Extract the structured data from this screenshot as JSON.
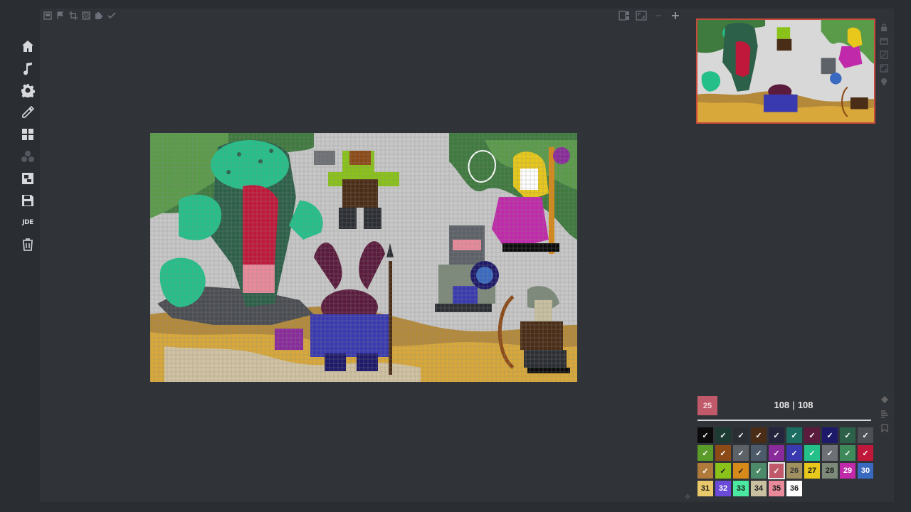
{
  "palette": {
    "current": "25",
    "count_left": "108",
    "count_right": "108",
    "separator": "|",
    "swatches": [
      [
        {
          "label": "✓",
          "bg": "#0b0b0b",
          "fg": "#ffffff"
        },
        {
          "label": "✓",
          "bg": "#1d3b33",
          "fg": "#ffffff"
        },
        {
          "label": "✓",
          "bg": "#2b2e33",
          "fg": "#ffffff"
        },
        {
          "label": "✓",
          "bg": "#4a2d17",
          "fg": "#ffffff"
        },
        {
          "label": "✓",
          "bg": "#25253d",
          "fg": "#ffffff"
        },
        {
          "label": "✓",
          "bg": "#1c6d62",
          "fg": "#ffffff"
        },
        {
          "label": "✓",
          "bg": "#5a1b3d",
          "fg": "#ffffff"
        },
        {
          "label": "✓",
          "bg": "#1e1a6a",
          "fg": "#ffffff"
        },
        {
          "label": "✓",
          "bg": "#2d6049",
          "fg": "#ffffff"
        },
        {
          "label": "✓",
          "bg": "#4d5055",
          "fg": "#ffffff"
        }
      ],
      [
        {
          "label": "✓",
          "bg": "#5a9b2a",
          "fg": "#ffffff"
        },
        {
          "label": "✓",
          "bg": "#8c4a17",
          "fg": "#ffffff"
        },
        {
          "label": "✓",
          "bg": "#5d6268",
          "fg": "#ffffff"
        },
        {
          "label": "✓",
          "bg": "#4d5a6a",
          "fg": "#ffffff"
        },
        {
          "label": "✓",
          "bg": "#8a2b9b",
          "fg": "#ffffff"
        },
        {
          "label": "✓",
          "bg": "#3a3ab0",
          "fg": "#ffffff"
        },
        {
          "label": "✓",
          "bg": "#25c08a",
          "fg": "#ffffff"
        },
        {
          "label": "✓",
          "bg": "#6d7075",
          "fg": "#ffffff"
        },
        {
          "label": "✓",
          "bg": "#3f8a5a",
          "fg": "#ffffff"
        },
        {
          "label": "✓",
          "bg": "#c0183a",
          "fg": "#ffffff"
        }
      ],
      [
        {
          "label": "✓",
          "bg": "#b07a3a",
          "fg": "#ffffff"
        },
        {
          "label": "✓",
          "bg": "#8ac21a",
          "fg": "#1d1d1d"
        },
        {
          "label": "✓",
          "bg": "#d68a1a",
          "fg": "#1d1d1d"
        },
        {
          "label": "✓",
          "bg": "#4d8a6a",
          "fg": "#ffffff"
        },
        {
          "label": "✓",
          "bg": "#c05a6a",
          "fg": "#ffffff",
          "selected": true
        },
        {
          "label": "26",
          "bg": "#a09060",
          "fg": "#3a3a3a"
        },
        {
          "label": "27",
          "bg": "#e8c81a",
          "fg": "#1d1d1d"
        },
        {
          "label": "28",
          "bg": "#7d8a7a",
          "fg": "#1d1d1d"
        },
        {
          "label": "29",
          "bg": "#c02aaa",
          "fg": "#ffffff"
        },
        {
          "label": "30",
          "bg": "#3a6ac0",
          "fg": "#ffffff"
        }
      ],
      [
        {
          "label": "31",
          "bg": "#e8c86a",
          "fg": "#1d1d1d"
        },
        {
          "label": "32",
          "bg": "#6a4ad8",
          "fg": "#ffffff"
        },
        {
          "label": "33",
          "bg": "#4ae8a0",
          "fg": "#1d1d1d"
        },
        {
          "label": "34",
          "bg": "#c8c0a0",
          "fg": "#1d1d1d"
        },
        {
          "label": "35",
          "bg": "#e88a9a",
          "fg": "#1d1d1d"
        },
        {
          "label": "36",
          "bg": "#ffffff",
          "fg": "#1d1d1d"
        }
      ]
    ]
  },
  "sidebar": {
    "items": [
      {
        "name": "home-icon"
      },
      {
        "name": "music-icon"
      },
      {
        "name": "gear-icon"
      },
      {
        "name": "pencil-icon"
      },
      {
        "name": "grid-icon"
      },
      {
        "name": "color-blobs-icon"
      },
      {
        "name": "export-icon"
      },
      {
        "name": "save-icon"
      },
      {
        "name": "jde-icon",
        "text": "JDE"
      },
      {
        "name": "trash-icon"
      }
    ]
  }
}
